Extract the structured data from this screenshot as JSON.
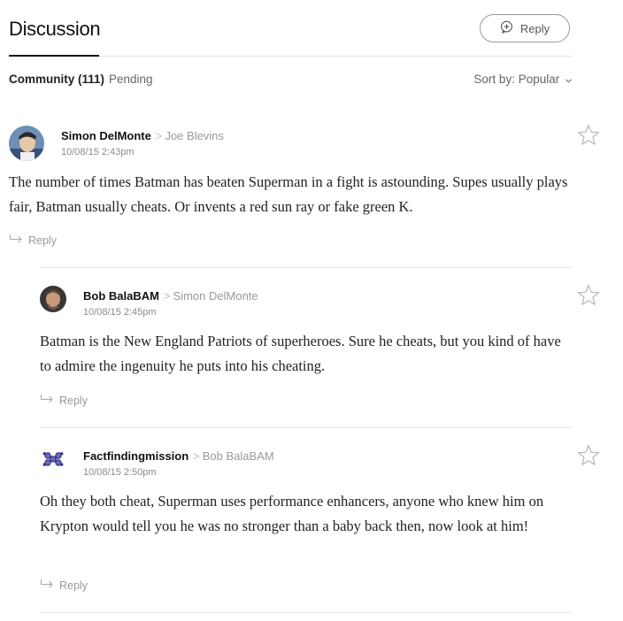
{
  "header": {
    "title": "Discussion",
    "reply_button_label": "Reply"
  },
  "tabs": {
    "community_label": "Community (111)",
    "pending_label": "Pending",
    "sort_label": "Sort by: Popular"
  },
  "comments": [
    {
      "author": "Simon DelMonte",
      "reply_to": "Joe Blevins",
      "timestamp": "10/08/15 2:43pm",
      "body": "The number of times Batman has beaten Superman in a fight is astounding. Supes usually plays fair, Batman usually cheats. Or invents a red sun ray or fake green K.",
      "reply_label": "Reply"
    },
    {
      "author": "Bob BalaBAM",
      "reply_to": "Simon DelMonte",
      "timestamp": "10/08/15 2:45pm",
      "body": "Batman is the New England Patriots of superheroes. Sure he cheats, but you kind of have to admire the ingenuity he puts into his cheating.",
      "reply_label": "Reply"
    },
    {
      "author": "Factfindingmission",
      "reply_to": "Bob BalaBAM",
      "timestamp": "10/08/15 2:50pm",
      "body": "Oh they both cheat, Superman uses performance enhancers, anyone who knew him on Krypton would tell you he was no stronger than a baby back then, now look at him!",
      "reply_label": "Reply"
    }
  ],
  "icons": {
    "reply_button": "plus-bubble-icon",
    "star": "star-outline-icon",
    "reply_arrow": "reply-arrow-icon",
    "chevron": "chevron-down-icon"
  }
}
